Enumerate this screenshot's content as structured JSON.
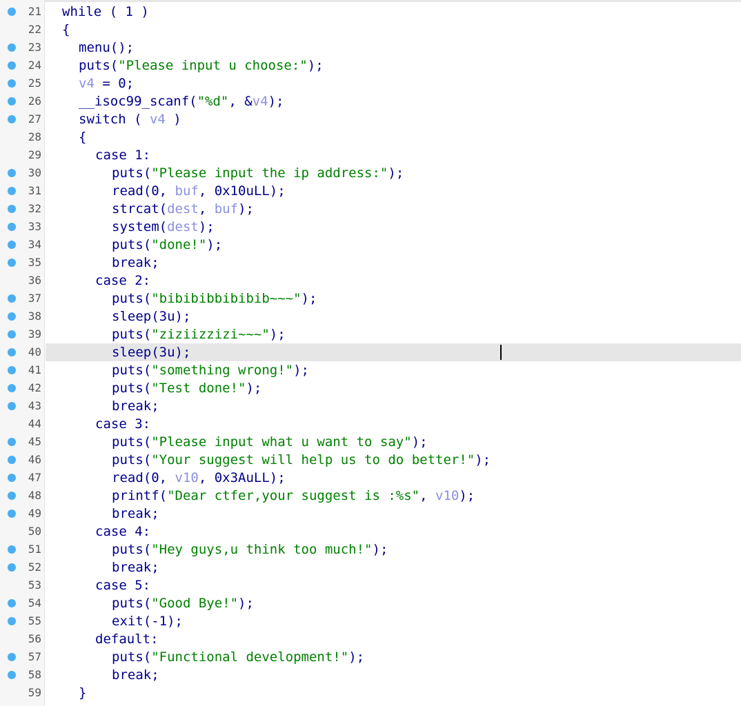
{
  "lines": [
    {
      "n": "21",
      "bp": true,
      "indent": 0,
      "tokens": [
        {
          "t": "while ( 1 )",
          "k": "kw"
        }
      ]
    },
    {
      "n": "22",
      "bp": false,
      "indent": 0,
      "tokens": [
        {
          "t": "{",
          "k": "kw"
        }
      ]
    },
    {
      "n": "23",
      "bp": true,
      "indent": 1,
      "tokens": [
        {
          "t": "menu();",
          "k": "kw"
        }
      ]
    },
    {
      "n": "24",
      "bp": true,
      "indent": 1,
      "tokens": [
        {
          "t": "puts(",
          "k": "kw"
        },
        {
          "t": "\"Please input u choose:\"",
          "k": "str"
        },
        {
          "t": ");",
          "k": "kw"
        }
      ]
    },
    {
      "n": "25",
      "bp": true,
      "indent": 1,
      "tokens": [
        {
          "t": "v4",
          "k": "var"
        },
        {
          "t": " = 0;",
          "k": "kw"
        }
      ]
    },
    {
      "n": "26",
      "bp": true,
      "indent": 1,
      "tokens": [
        {
          "t": "__isoc99_scanf(",
          "k": "kw"
        },
        {
          "t": "\"%d\"",
          "k": "str"
        },
        {
          "t": ", &",
          "k": "kw"
        },
        {
          "t": "v4",
          "k": "var"
        },
        {
          "t": ");",
          "k": "kw"
        }
      ]
    },
    {
      "n": "27",
      "bp": true,
      "indent": 1,
      "tokens": [
        {
          "t": "switch ( ",
          "k": "kw"
        },
        {
          "t": "v4",
          "k": "var"
        },
        {
          "t": " )",
          "k": "kw"
        }
      ]
    },
    {
      "n": "28",
      "bp": false,
      "indent": 1,
      "tokens": [
        {
          "t": "{",
          "k": "kw"
        }
      ]
    },
    {
      "n": "29",
      "bp": false,
      "indent": 2,
      "tokens": [
        {
          "t": "case 1:",
          "k": "kw"
        }
      ]
    },
    {
      "n": "30",
      "bp": true,
      "indent": 3,
      "tokens": [
        {
          "t": "puts(",
          "k": "kw"
        },
        {
          "t": "\"Please input the ip address:\"",
          "k": "str"
        },
        {
          "t": ");",
          "k": "kw"
        }
      ]
    },
    {
      "n": "31",
      "bp": true,
      "indent": 3,
      "tokens": [
        {
          "t": "read(0, ",
          "k": "kw"
        },
        {
          "t": "buf",
          "k": "var"
        },
        {
          "t": ", 0x10uLL);",
          "k": "kw"
        }
      ]
    },
    {
      "n": "32",
      "bp": true,
      "indent": 3,
      "tokens": [
        {
          "t": "strcat(",
          "k": "kw"
        },
        {
          "t": "dest",
          "k": "var"
        },
        {
          "t": ", ",
          "k": "kw"
        },
        {
          "t": "buf",
          "k": "var"
        },
        {
          "t": ");",
          "k": "kw"
        }
      ]
    },
    {
      "n": "33",
      "bp": true,
      "indent": 3,
      "tokens": [
        {
          "t": "system(",
          "k": "kw"
        },
        {
          "t": "dest",
          "k": "var"
        },
        {
          "t": ");",
          "k": "kw"
        }
      ]
    },
    {
      "n": "34",
      "bp": true,
      "indent": 3,
      "tokens": [
        {
          "t": "puts(",
          "k": "kw"
        },
        {
          "t": "\"done!\"",
          "k": "str"
        },
        {
          "t": ");",
          "k": "kw"
        }
      ]
    },
    {
      "n": "35",
      "bp": true,
      "indent": 3,
      "tokens": [
        {
          "t": "break;",
          "k": "kw"
        }
      ]
    },
    {
      "n": "36",
      "bp": false,
      "indent": 2,
      "tokens": [
        {
          "t": "case 2:",
          "k": "kw"
        }
      ]
    },
    {
      "n": "37",
      "bp": true,
      "indent": 3,
      "tokens": [
        {
          "t": "puts(",
          "k": "kw"
        },
        {
          "t": "\"bibibibbibibib~~~\"",
          "k": "str"
        },
        {
          "t": ");",
          "k": "kw"
        }
      ]
    },
    {
      "n": "38",
      "bp": true,
      "indent": 3,
      "tokens": [
        {
          "t": "sleep(3u);",
          "k": "kw"
        }
      ]
    },
    {
      "n": "39",
      "bp": true,
      "indent": 3,
      "tokens": [
        {
          "t": "puts(",
          "k": "kw"
        },
        {
          "t": "\"ziziizzizi~~~\"",
          "k": "str"
        },
        {
          "t": ");",
          "k": "kw"
        }
      ]
    },
    {
      "n": "40",
      "bp": true,
      "indent": 3,
      "current": true,
      "tokens": [
        {
          "t": "sleep(3u);",
          "k": "kw"
        }
      ]
    },
    {
      "n": "41",
      "bp": true,
      "indent": 3,
      "tokens": [
        {
          "t": "puts(",
          "k": "kw"
        },
        {
          "t": "\"something wrong!\"",
          "k": "str"
        },
        {
          "t": ");",
          "k": "kw"
        }
      ]
    },
    {
      "n": "42",
      "bp": true,
      "indent": 3,
      "tokens": [
        {
          "t": "puts(",
          "k": "kw"
        },
        {
          "t": "\"Test done!\"",
          "k": "str"
        },
        {
          "t": ");",
          "k": "kw"
        }
      ]
    },
    {
      "n": "43",
      "bp": true,
      "indent": 3,
      "tokens": [
        {
          "t": "break;",
          "k": "kw"
        }
      ]
    },
    {
      "n": "44",
      "bp": false,
      "indent": 2,
      "tokens": [
        {
          "t": "case 3:",
          "k": "kw"
        }
      ]
    },
    {
      "n": "45",
      "bp": true,
      "indent": 3,
      "tokens": [
        {
          "t": "puts(",
          "k": "kw"
        },
        {
          "t": "\"Please input what u want to say\"",
          "k": "str"
        },
        {
          "t": ");",
          "k": "kw"
        }
      ]
    },
    {
      "n": "46",
      "bp": true,
      "indent": 3,
      "tokens": [
        {
          "t": "puts(",
          "k": "kw"
        },
        {
          "t": "\"Your suggest will help us to do better!\"",
          "k": "str"
        },
        {
          "t": ");",
          "k": "kw"
        }
      ]
    },
    {
      "n": "47",
      "bp": true,
      "indent": 3,
      "tokens": [
        {
          "t": "read(0, ",
          "k": "kw"
        },
        {
          "t": "v10",
          "k": "var"
        },
        {
          "t": ", 0x3AuLL);",
          "k": "kw"
        }
      ]
    },
    {
      "n": "48",
      "bp": true,
      "indent": 3,
      "tokens": [
        {
          "t": "printf(",
          "k": "kw"
        },
        {
          "t": "\"Dear ctfer,your suggest is :%s\"",
          "k": "str"
        },
        {
          "t": ", ",
          "k": "kw"
        },
        {
          "t": "v10",
          "k": "var"
        },
        {
          "t": ");",
          "k": "kw"
        }
      ]
    },
    {
      "n": "49",
      "bp": true,
      "indent": 3,
      "tokens": [
        {
          "t": "break;",
          "k": "kw"
        }
      ]
    },
    {
      "n": "50",
      "bp": false,
      "indent": 2,
      "tokens": [
        {
          "t": "case 4:",
          "k": "kw"
        }
      ]
    },
    {
      "n": "51",
      "bp": true,
      "indent": 3,
      "tokens": [
        {
          "t": "puts(",
          "k": "kw"
        },
        {
          "t": "\"Hey guys,u think too much!\"",
          "k": "str"
        },
        {
          "t": ");",
          "k": "kw"
        }
      ]
    },
    {
      "n": "52",
      "bp": true,
      "indent": 3,
      "tokens": [
        {
          "t": "break;",
          "k": "kw"
        }
      ]
    },
    {
      "n": "53",
      "bp": false,
      "indent": 2,
      "tokens": [
        {
          "t": "case 5:",
          "k": "kw"
        }
      ]
    },
    {
      "n": "54",
      "bp": true,
      "indent": 3,
      "tokens": [
        {
          "t": "puts(",
          "k": "kw"
        },
        {
          "t": "\"Good Bye!\"",
          "k": "str"
        },
        {
          "t": ");",
          "k": "kw"
        }
      ]
    },
    {
      "n": "55",
      "bp": true,
      "indent": 3,
      "tokens": [
        {
          "t": "exit(-1);",
          "k": "kw"
        }
      ]
    },
    {
      "n": "56",
      "bp": false,
      "indent": 2,
      "tokens": [
        {
          "t": "default:",
          "k": "kw"
        }
      ]
    },
    {
      "n": "57",
      "bp": true,
      "indent": 3,
      "tokens": [
        {
          "t": "puts(",
          "k": "kw"
        },
        {
          "t": "\"Functional development!\"",
          "k": "str"
        },
        {
          "t": ");",
          "k": "kw"
        }
      ]
    },
    {
      "n": "58",
      "bp": true,
      "indent": 3,
      "tokens": [
        {
          "t": "break;",
          "k": "kw"
        }
      ]
    },
    {
      "n": "59",
      "bp": false,
      "indent": 1,
      "tokens": [
        {
          "t": "}",
          "k": "kw"
        }
      ]
    }
  ],
  "colors": {
    "keyword": "#00008b",
    "string": "#008000",
    "variable": "#8a8fe0",
    "breakpoint": "#4aaff0",
    "current_line": "#e6e6e6"
  }
}
